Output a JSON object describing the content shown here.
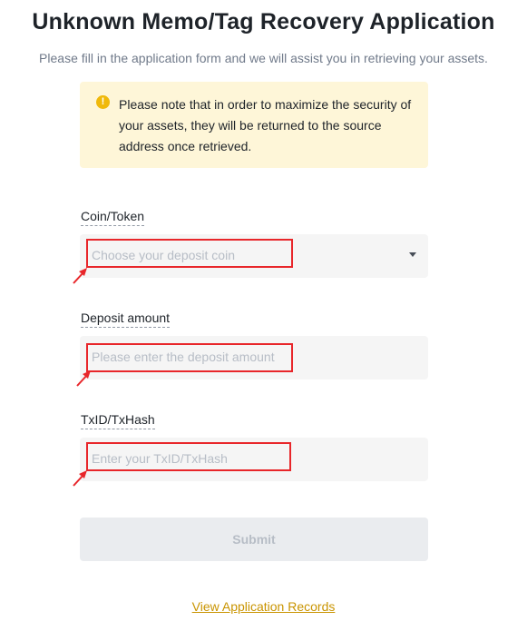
{
  "header": {
    "title": "Unknown Memo/Tag Recovery Application",
    "subtitle": "Please fill in the application form and we will assist you in retrieving your assets."
  },
  "notice": {
    "icon": "warning-icon",
    "text": "Please note that in order to maximize the security of your assets, they will be returned to the source address once retrieved.",
    "color": "#fef6d8"
  },
  "form": {
    "coin": {
      "label": "Coin/Token",
      "placeholder": "Choose your deposit coin"
    },
    "amount": {
      "label": "Deposit amount",
      "placeholder": "Please enter the deposit amount"
    },
    "txid": {
      "label": "TxID/TxHash",
      "placeholder": "Enter your TxID/TxHash"
    },
    "submit_label": "Submit"
  },
  "footer": {
    "records_link": "View Application Records"
  },
  "colors": {
    "accent": "#f0b90b",
    "link": "#c99400",
    "annotation": "#e8262a"
  }
}
